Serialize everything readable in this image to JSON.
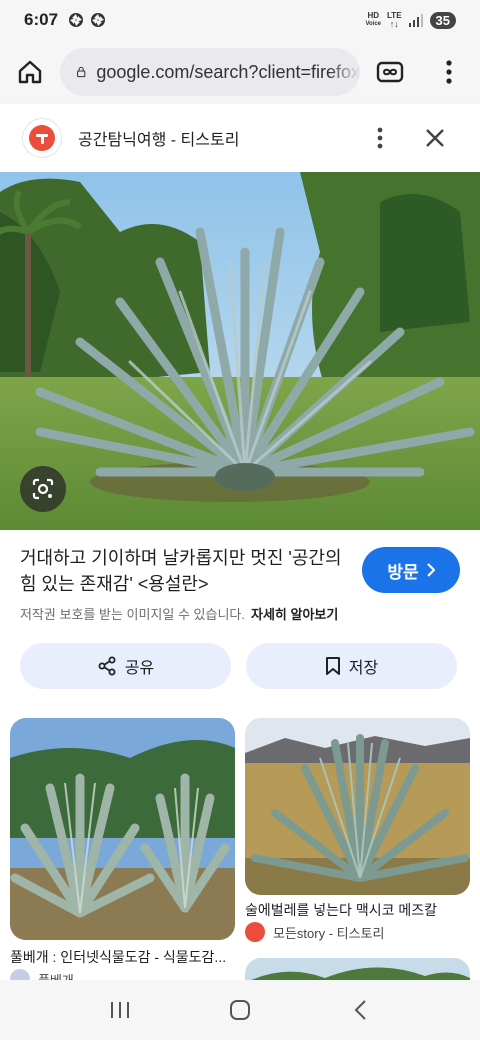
{
  "status_bar": {
    "time": "6:07",
    "hd_label": "HD",
    "voice_label": "Voice",
    "network": "LTE",
    "battery": "35"
  },
  "browser": {
    "url": "google.com/search?client=firefox"
  },
  "source": {
    "title": "공간탐닉여행 - 티스토리"
  },
  "result": {
    "title": "거대하고 기이하며 날카롭지만 멋진 '공간의 힘 있는 존재감' <용설란>",
    "visit_label": "방문",
    "copyright_notice": "저작권 보호를 받는 이미지일 수 있습니다.",
    "learn_more": "자세히 알아보기",
    "share_label": "공유",
    "save_label": "저장"
  },
  "related": [
    {
      "caption": "풀베개 : 인터넷식물도감 - 식물도감...",
      "source": "풀베개"
    },
    {
      "caption": "술에벌레를 넣는다 맥시코 메즈칼",
      "source": "모든story - 티스토리"
    }
  ],
  "icons": {
    "home": "home-icon",
    "lock": "lock-icon",
    "tabs": "tab-switcher-icon",
    "menu": "more-vert-icon",
    "lens": "lens-search-icon",
    "share": "share-icon",
    "save": "bookmark-icon",
    "close": "close-icon"
  },
  "colors": {
    "accent": "#1a73e8",
    "chip_bg": "#e8eefb",
    "favicon": "#eb4c3c"
  }
}
